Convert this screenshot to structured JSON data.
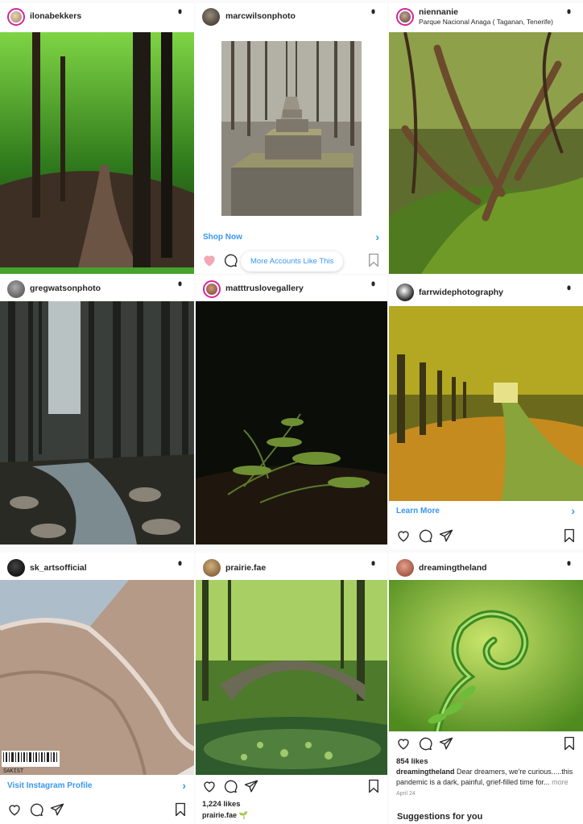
{
  "posts": [
    {
      "username": "ilonabekkers",
      "location": "",
      "cta": "",
      "likes": "",
      "caption_user": "",
      "caption_text": "",
      "more": "",
      "date": ""
    },
    {
      "username": "marcwilsonphoto",
      "location": "",
      "cta": "Shop Now",
      "likes": "",
      "caption_user": "",
      "caption_text": "",
      "more": "",
      "date": ""
    },
    {
      "username": "niennanie",
      "location": "Parque Nacional Anaga ( Taganan, Tenerife)",
      "cta": "",
      "likes": "",
      "caption_user": "",
      "caption_text": "",
      "more": "",
      "date": ""
    },
    {
      "username": "gregwatsonphoto",
      "location": "",
      "cta": "",
      "likes": "",
      "caption_user": "",
      "caption_text": "",
      "more": "",
      "date": ""
    },
    {
      "username": "matttruslovegallery",
      "location": "",
      "cta": "",
      "likes": "",
      "caption_user": "",
      "caption_text": "",
      "more": "",
      "date": ""
    },
    {
      "username": "farrwidephotography",
      "location": "",
      "cta": "Learn More",
      "likes": "",
      "caption_user": "",
      "caption_text": "",
      "more": "",
      "date": ""
    },
    {
      "username": "sk_artsofficial",
      "location": "",
      "cta": "Visit Instagram Profile",
      "likes": "",
      "caption_user": "",
      "caption_text": "",
      "more": "",
      "date": ""
    },
    {
      "username": "prairie.fae",
      "location": "",
      "cta": "",
      "likes": "1,224 likes",
      "caption_user": "prairie.fae",
      "caption_text": "🌱",
      "more": "",
      "date": ""
    },
    {
      "username": "dreamingtheland",
      "location": "",
      "cta": "",
      "likes": "854 likes",
      "caption_user": "dreamingtheland",
      "caption_text": "Dear dreamers, we're curious.....this pandemic is a dark, painful, grief-filled time for...",
      "more": "more",
      "date": "April 24"
    }
  ],
  "more_accounts_label": "More Accounts Like This",
  "suggestions_label": "Suggestions for you",
  "photo_watermark": "SAKIST",
  "icons": {
    "menu": "more-vertical-icon",
    "like": "heart-icon",
    "comment": "comment-icon",
    "share": "paper-plane-icon",
    "save": "bookmark-icon",
    "chevron": "chevron-right-icon"
  },
  "colors": {
    "link": "#3897f0",
    "like_active": "#ed4956",
    "text": "#262626",
    "muted": "#8e8e8e"
  }
}
